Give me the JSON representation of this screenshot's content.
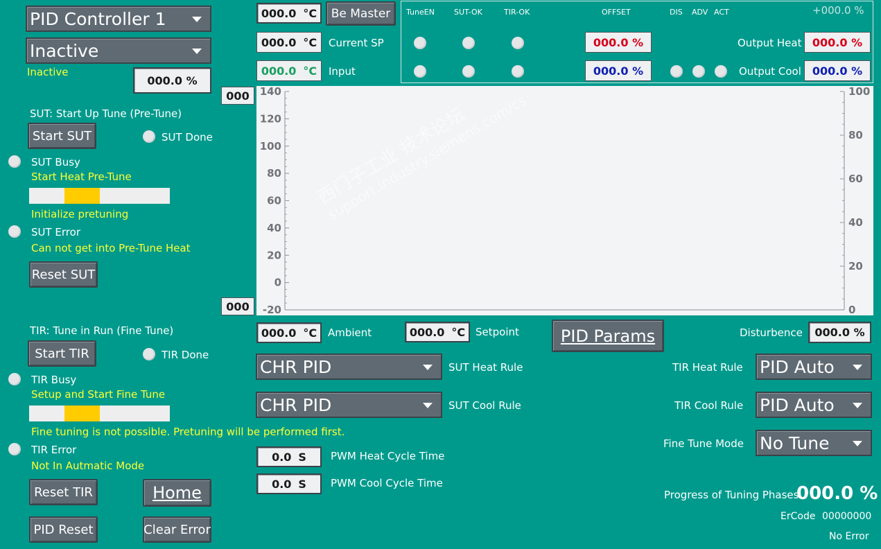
{
  "controller": {
    "select_value": "PID Controller 1",
    "state_value": "Inactive",
    "state_text": "Inactive",
    "state_percent": "000.0 %"
  },
  "sut": {
    "title": "SUT: Start Up Tune (Pre-Tune)",
    "start_label": "Start SUT",
    "done_label": "SUT Done",
    "busy_label": "SUT Busy",
    "phase_text": "Start Heat Pre-Tune",
    "progress_fraction": 0.25,
    "status_text": "Initialize pretuning",
    "error_label": "SUT Error",
    "error_text": "Can not get into Pre-Tune Heat",
    "reset_label": "Reset SUT"
  },
  "tir": {
    "title": "TIR: Tune in Run (Fine Tune)",
    "start_label": "Start TIR",
    "done_label": "TIR Done",
    "busy_label": "TIR Busy",
    "phase_text": "Setup and Start Fine Tune",
    "progress_fraction": 0.25,
    "status_text": "Fine tuning is not possible. Pretuning will be performed first.",
    "error_label": "TIR Error",
    "error_text": "Not In Autmatic Mode",
    "reset_label": "Reset TIR"
  },
  "nav": {
    "home_label": "Home",
    "pid_reset_label": "PID Reset",
    "clear_error_label": "Clear Error"
  },
  "top": {
    "master_value": "000.0",
    "master_unit": "°C",
    "be_master_label": "Be Master",
    "sp_value": "000.0",
    "sp_unit": "°C",
    "sp_label": "Current SP",
    "input_value": "000.0",
    "input_unit": "°C",
    "input_label": "Input"
  },
  "status_panel": {
    "headers": {
      "tune_en": "TuneEN",
      "sut_ok": "SUT-OK",
      "tir_ok": "TIR-OK",
      "offset": "OFFSET",
      "dis": "DIS",
      "adv": "ADV",
      "act": "ACT"
    },
    "readout": "+000.0 %",
    "offset_heat": "000.0 %",
    "offset_cool": "000.0 %",
    "output_heat_label": "Output Heat",
    "output_heat": "000.0 %",
    "output_cool_label": "Output Cool",
    "output_cool": "000.0 %"
  },
  "chart_data": {
    "type": "line",
    "left_axis": {
      "ylim": [
        -20,
        140
      ],
      "ticks": [
        -20,
        0,
        20,
        40,
        60,
        80,
        100,
        120,
        140
      ],
      "max_field": "000",
      "min_field": "000"
    },
    "right_axis": {
      "ylim": [
        0,
        100
      ],
      "ticks": [
        0,
        20,
        40,
        60,
        80,
        100
      ]
    },
    "series": []
  },
  "bottom": {
    "ambient_value": "000.0",
    "ambient_unit": "°C",
    "ambient_label": "Ambient",
    "setpoint_value": "000.0",
    "setpoint_unit": "°C",
    "setpoint_label": "Setpoint",
    "pid_params_label": "PID Params",
    "disturbance_label": "Disturbence",
    "disturbance_value": "000.0 %",
    "sut_heat_rule_value": "CHR PID",
    "sut_heat_rule_label": "SUT Heat Rule",
    "sut_cool_rule_value": "CHR PID",
    "sut_cool_rule_label": "SUT Cool Rule",
    "tir_heat_rule_label": "TIR Heat Rule",
    "tir_heat_rule_value": "PID Auto",
    "tir_cool_rule_label": "TIR Cool Rule",
    "tir_cool_rule_value": "PID Auto",
    "fine_tune_mode_label": "Fine Tune Mode",
    "fine_tune_mode_value": "No Tune",
    "pwm_heat_value": "0.0",
    "pwm_heat_unit": "S",
    "pwm_heat_label": "PWM Heat Cycle Time",
    "pwm_cool_value": "0.0",
    "pwm_cool_unit": "S",
    "pwm_cool_label": "PWM Cool Cycle Time",
    "progress_label": "Progress of Tuning Phases",
    "progress_value": "000.0 %",
    "ercode_label": "ErCode",
    "ercode_value": "00000000",
    "error_status": "No Error"
  },
  "watermark": {
    "line1": "西门子工业 技术论坛",
    "line2": "support.industry.siemens.com/cs"
  }
}
